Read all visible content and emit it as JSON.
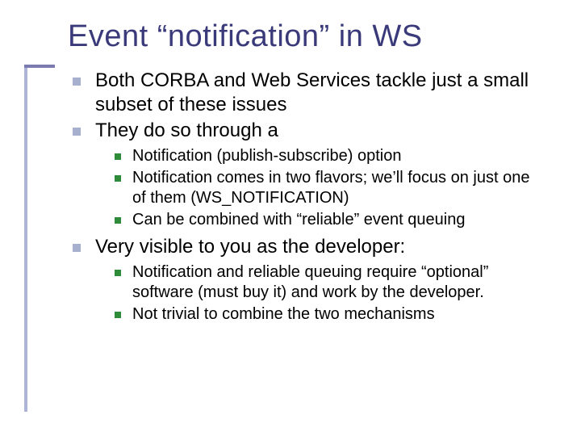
{
  "title": "Event “notification” in WS",
  "bullets": {
    "b1": "Both CORBA and Web Services tackle just a small subset of these issues",
    "b2": "They do so through a",
    "b2_sub": {
      "s1": "Notification (publish-subscribe) option",
      "s2": "Notification comes in two flavors; we’ll focus on just one of them (WS_NOTIFICATION)",
      "s3": "Can be combined with “reliable” event queuing"
    },
    "b3": "Very visible to you as the developer:",
    "b3_sub": {
      "s1": "Notification and reliable queuing require “optional” software (must buy it) and work by the developer.",
      "s2": "Not trivial to combine the two mechanisms"
    }
  }
}
